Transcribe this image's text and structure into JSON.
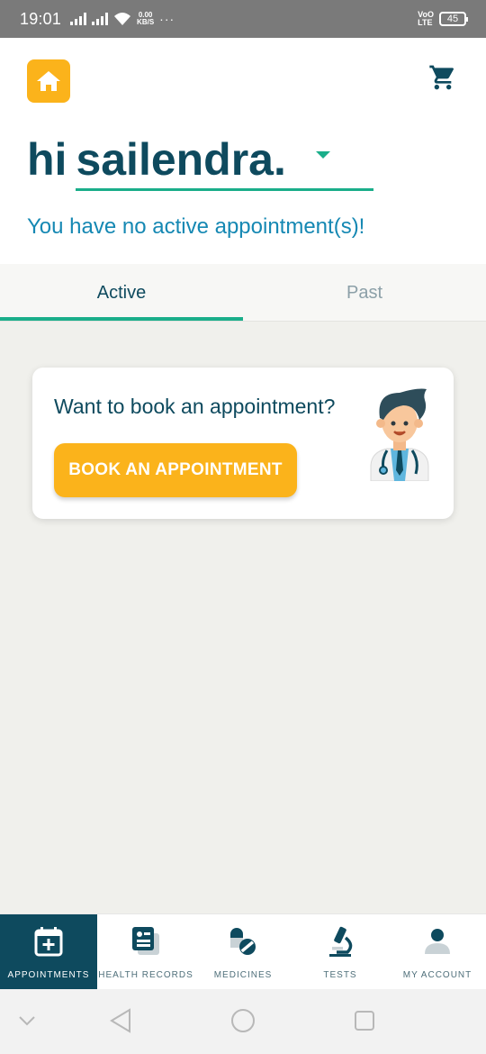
{
  "status_bar": {
    "time": "19:01",
    "net_speed_value": "0.00",
    "net_speed_unit": "KB/S",
    "more": "···",
    "volte_top": "VoO",
    "volte_bottom": "LTE",
    "battery": "45"
  },
  "header": {
    "greeting": "hi",
    "user_name": "sailendra.",
    "appointment_status": "You have no active appointment(s)!"
  },
  "tabs": [
    {
      "label": "Active",
      "active": true
    },
    {
      "label": "Past",
      "active": false
    }
  ],
  "card": {
    "title": "Want to book an appointment?",
    "button_label": "BOOK AN APPOINTMENT"
  },
  "bottom_nav": [
    {
      "label": "APPOINTMENTS",
      "icon": "calendar-plus-icon",
      "active": true
    },
    {
      "label": "HEALTH RECORDS",
      "icon": "records-icon",
      "active": false
    },
    {
      "label": "MEDICINES",
      "icon": "pills-icon",
      "active": false
    },
    {
      "label": "TESTS",
      "icon": "microscope-icon",
      "active": false
    },
    {
      "label": "MY ACCOUNT",
      "icon": "person-icon",
      "active": false
    }
  ],
  "colors": {
    "brand_dark": "#0e4a5e",
    "accent_yellow": "#fbb31b",
    "accent_green": "#1aae8a",
    "link_blue": "#1588b3"
  }
}
